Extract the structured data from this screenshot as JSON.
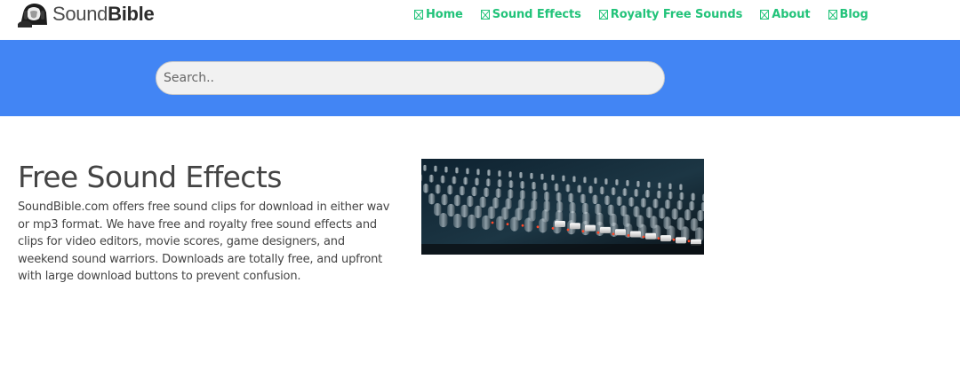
{
  "header": {
    "logo": {
      "text_light": "Sound",
      "text_bold": "Bible"
    },
    "nav": [
      {
        "label": "Home"
      },
      {
        "label": "Sound Effects"
      },
      {
        "label": "Royalty Free Sounds"
      },
      {
        "label": "About"
      },
      {
        "label": "Blog"
      }
    ]
  },
  "search": {
    "placeholder": "Search.."
  },
  "main": {
    "title": "Free Sound Effects",
    "intro": "SoundBible.com offers free sound clips for download in either wav or mp3 format. We have free and royalty free sound effects and clips for video editors, movie scores, game designers, and weekend sound warriors. Downloads are totally free, and upfront with large download buttons to prevent confusion."
  },
  "colors": {
    "accent_green": "#22c37a",
    "band_blue": "#4285f4",
    "text": "#444444"
  },
  "icons": {
    "nav": "missing-glyph-icon",
    "logo": "headphone-person-logo-icon"
  }
}
